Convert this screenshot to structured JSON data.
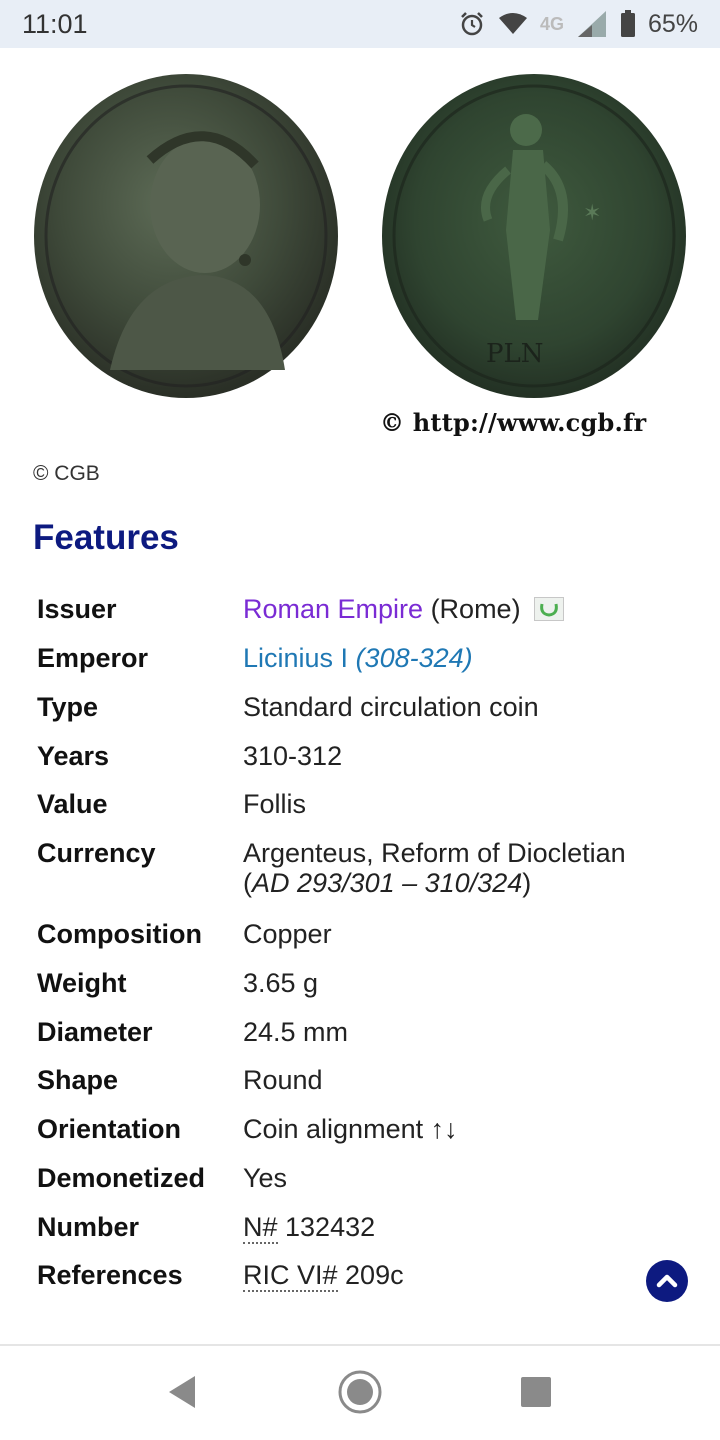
{
  "status_bar": {
    "time": "11:01",
    "network": "4G",
    "battery": "65%",
    "icons": [
      "alarm-icon",
      "wifi-icon",
      "network-4g-icon",
      "signal-icon",
      "battery-icon"
    ]
  },
  "images": {
    "watermark": "© http://www.cgb.fr",
    "credit": "© CGB"
  },
  "features": {
    "title": "Features",
    "rows": [
      {
        "label": "Issuer",
        "value_link": "Roman Empire",
        "value_rest": " (Rome)"
      },
      {
        "label": "Emperor",
        "value_link": "Licinius I",
        "value_italic": "(308-324)"
      },
      {
        "label": "Type",
        "value": "Standard circulation coin"
      },
      {
        "label": "Years",
        "value": "310-312"
      },
      {
        "label": "Value",
        "value": "Follis"
      },
      {
        "label": "Currency",
        "value": "Argenteus, Reform of Diocletian",
        "value_line2_open": "(",
        "value_line2_italic": "AD 293/301 – 310/324",
        "value_line2_close": ")"
      },
      {
        "label": "Composition",
        "value": "Copper"
      },
      {
        "label": "Weight",
        "value": "3.65 g"
      },
      {
        "label": "Diameter",
        "value": "24.5 mm"
      },
      {
        "label": "Shape",
        "value": "Round"
      },
      {
        "label": "Orientation",
        "value": "Coin alignment ↑↓"
      },
      {
        "label": "Demonetized",
        "value": "Yes"
      },
      {
        "label": "Number",
        "value_dotted": "N#",
        "value_rest": " 132432"
      },
      {
        "label": "References",
        "value_dotted": "RIC VI#",
        "value_rest": " 209c"
      }
    ]
  },
  "colors": {
    "title": "#0d1a80",
    "issuer_link": "#7a2bd4",
    "emperor_link": "#1f78b4",
    "status_bar_bg": "#e8eef6"
  },
  "nav": {
    "icons": [
      "back-icon",
      "home-icon",
      "recents-icon"
    ]
  }
}
